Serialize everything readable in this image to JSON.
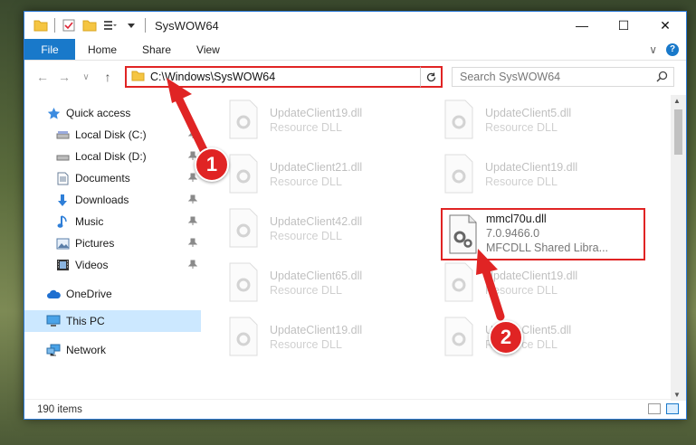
{
  "window": {
    "title": "SysWOW64",
    "controls": {
      "minimize": "—",
      "maximize": "☐",
      "close": "✕"
    }
  },
  "ribbon": {
    "tabs": [
      "File",
      "Home",
      "Share",
      "View"
    ],
    "help": "?",
    "expand": "∨"
  },
  "navigation": {
    "back": "←",
    "forward": "→",
    "recent": "∨",
    "up": "↑",
    "address": "C:\\Windows\\SysWOW64",
    "search_placeholder": "Search SysWOW64"
  },
  "sidebar": {
    "items": [
      {
        "label": "Quick access",
        "icon": "star-icon"
      },
      {
        "label": "Local Disk (C:)",
        "icon": "drive-icon"
      },
      {
        "label": "Local Disk (D:)",
        "icon": "drive-icon"
      },
      {
        "label": "Documents",
        "icon": "documents-icon"
      },
      {
        "label": "Downloads",
        "icon": "download-icon"
      },
      {
        "label": "Music",
        "icon": "music-icon"
      },
      {
        "label": "Pictures",
        "icon": "pictures-icon"
      },
      {
        "label": "Videos",
        "icon": "videos-icon"
      },
      {
        "label": "OneDrive",
        "icon": "cloud-icon"
      },
      {
        "label": "This PC",
        "icon": "computer-icon"
      },
      {
        "label": "Network",
        "icon": "network-icon"
      }
    ]
  },
  "files": [
    {
      "name": "UpdateClient19.dll",
      "desc": "Resource DLL"
    },
    {
      "name": "UpdateClient5.dll",
      "desc": "Resource DLL"
    },
    {
      "name": "UpdateClient21.dll",
      "desc": "Resource DLL"
    },
    {
      "name": "UpdateClient19.dll",
      "desc": "Resource DLL"
    },
    {
      "name": "UpdateClient42.dll",
      "desc": "Resource DLL"
    },
    {
      "name": "UpdateClient65.dll",
      "desc": "Resource DLL"
    },
    {
      "name": "UpdateClient19.dll",
      "desc": "Resource DLL"
    },
    {
      "name": "UpdateClient19.dll",
      "desc": "Resource DLL"
    },
    {
      "name": "UpdateClient5.dll",
      "desc": "Resource DLL"
    }
  ],
  "highlighted_file": {
    "name": "mmcl70u.dll",
    "version": "7.0.9466.0",
    "description": "MFCDLL Shared Libra..."
  },
  "status": {
    "item_count": "190 items"
  },
  "callouts": [
    "1",
    "2"
  ],
  "colors": {
    "accent": "#1979ca",
    "highlight": "#e02424",
    "selection": "#cce8ff"
  }
}
